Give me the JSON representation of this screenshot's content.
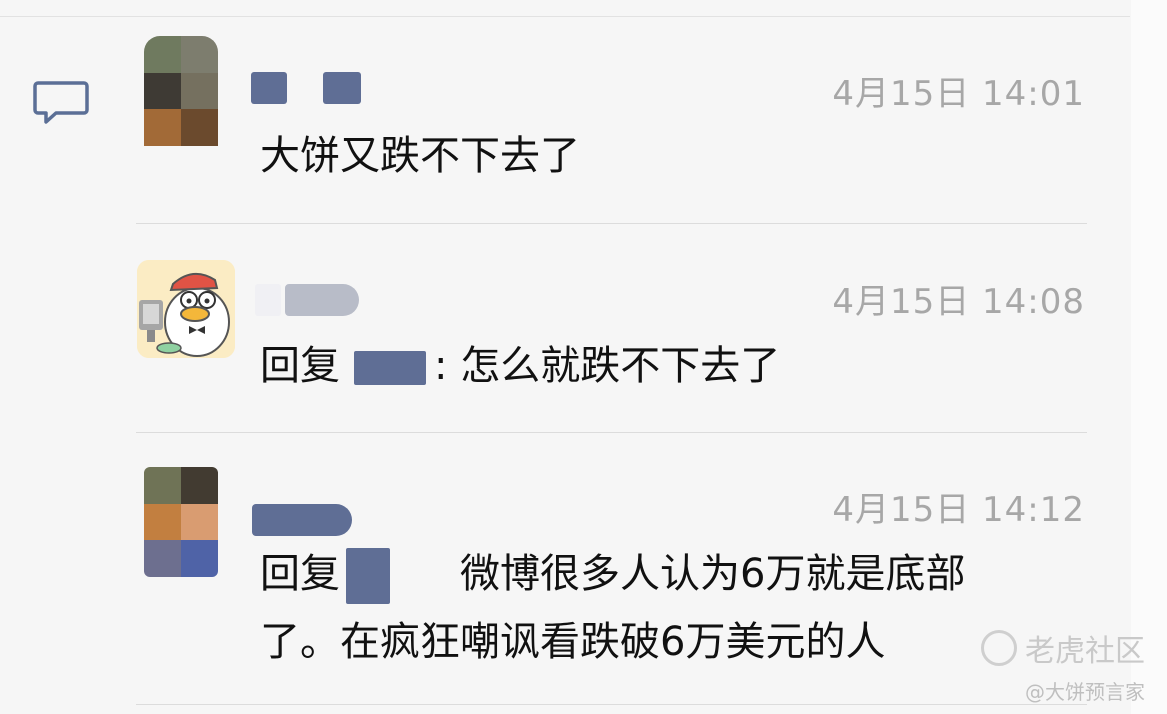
{
  "comments": [
    {
      "time": "4月15日 14:01",
      "text": "大饼又跌不下去了"
    },
    {
      "time": "4月15日 14:08",
      "reply_prefix": "回复",
      "reply_text": ": 怎么就跌不下去了"
    },
    {
      "time": "4月15日 14:12",
      "reply_prefix": "回复",
      "reply_text_line1": "微博很多人认为6万就是底部",
      "reply_text_line2": "了。在疯狂嘲讽看跌破6万美元的人"
    }
  ],
  "watermark": {
    "brand": "老虎社区",
    "user": "@大饼预言家"
  },
  "colors": {
    "background": "#f6f6f6",
    "time_text": "#a7a7a7",
    "blur_name": "#5f6e95"
  },
  "icons": {
    "comment": "speech-bubble-icon"
  }
}
